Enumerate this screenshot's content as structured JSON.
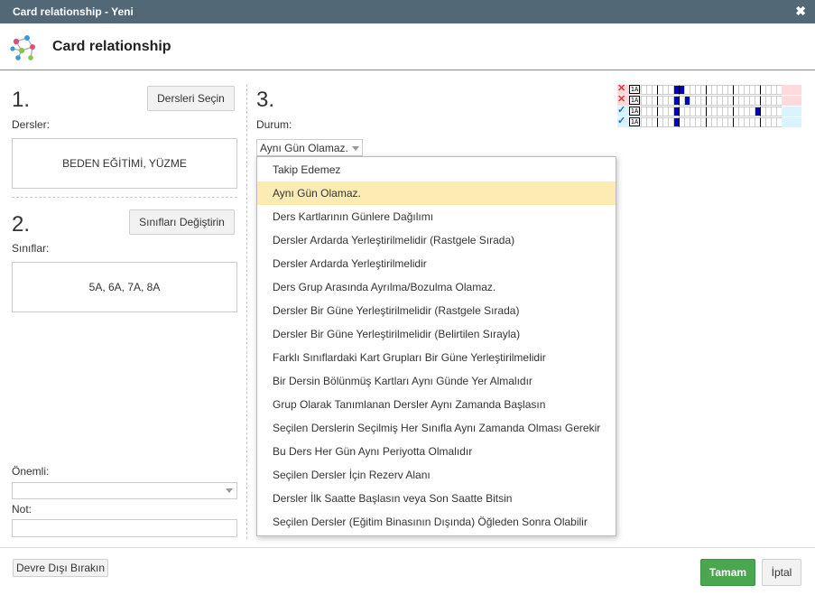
{
  "window": {
    "title": "Card relationship - Yeni",
    "close_label": "✖"
  },
  "header": {
    "title": "Card relationship",
    "icon": "network-relationship-icon"
  },
  "section1": {
    "number": "1.",
    "button": "Dersleri Seçin",
    "label": "Dersler:",
    "value": "BEDEN EĞİTİMİ, YÜZME"
  },
  "section2": {
    "number": "2.",
    "button": "Sınıfları Değiştirin",
    "label": "Sınıflar:",
    "value": "5A, 6A, 7A, 8A"
  },
  "onemli": {
    "label": "Önemli:",
    "value": ""
  },
  "not": {
    "label": "Not:",
    "value": ""
  },
  "section3": {
    "number": "3.",
    "label": "Durum:",
    "selected": "Aynı Gün Olamaz.",
    "options": [
      "Takip Edemez",
      "Aynı Gün Olamaz.",
      "Ders Kartlarının Günlere Dağılımı",
      "Dersler Ardarda Yerleştirilmelidir (Rastgele Sırada)",
      "Dersler Ardarda Yerleştirilmelidir",
      "Ders Grup Arasında Ayrılma/Bozulma Olamaz.",
      "Dersler Bir Güne Yerleştirilmelidir (Rastgele Sırada)",
      "Dersler Bir Güne Yerleştirilmelidir (Belirtilen Sırayla)",
      "Farklı Sınıflardaki Kart Grupları Bir Güne Yerleştirilmelidir",
      "Bir Dersin Bölünmüş Kartları Aynı Günde Yer Almalıdır",
      "Grup Olarak Tanımlanan Dersler Aynı Zamanda Başlasın",
      "Seçilen Derslerin Seçilmiş Her Sınıfla Aynı Zamanda Olması Gerekir",
      "Bu Ders Her Gün Aynı Periyotta Olmalıdır",
      "Seçilen Dersler İçin Rezerv Alanı",
      "Dersler İlk Saatte Başlasın veya Son Saatte Bitsin",
      "Seçilen Dersler (Eğitim Binasının Dışında) Öğleden Sonra Olabilir"
    ],
    "selected_index": 1
  },
  "preview": {
    "rows": [
      {
        "status": "invalid",
        "mark": "✕",
        "color": "#e8303a",
        "filled": [
          6,
          7
        ]
      },
      {
        "status": "invalid",
        "mark": "✕",
        "color": "#e8303a",
        "filled": [
          6,
          8
        ]
      },
      {
        "status": "valid",
        "mark": "✓",
        "color": "#1e6bd6",
        "filled": [
          6,
          21
        ]
      },
      {
        "status": "valid",
        "mark": "✓",
        "color": "#1e6bd6",
        "filled": [
          6
        ]
      }
    ]
  },
  "footer": {
    "disable_button": "Devre Dışı Bırakın",
    "ok_button": "Tamam",
    "cancel_button": "İptal"
  },
  "colors": {
    "titlebar": "#526876",
    "primary": "#4aa64f",
    "highlight": "#fcecb4"
  }
}
